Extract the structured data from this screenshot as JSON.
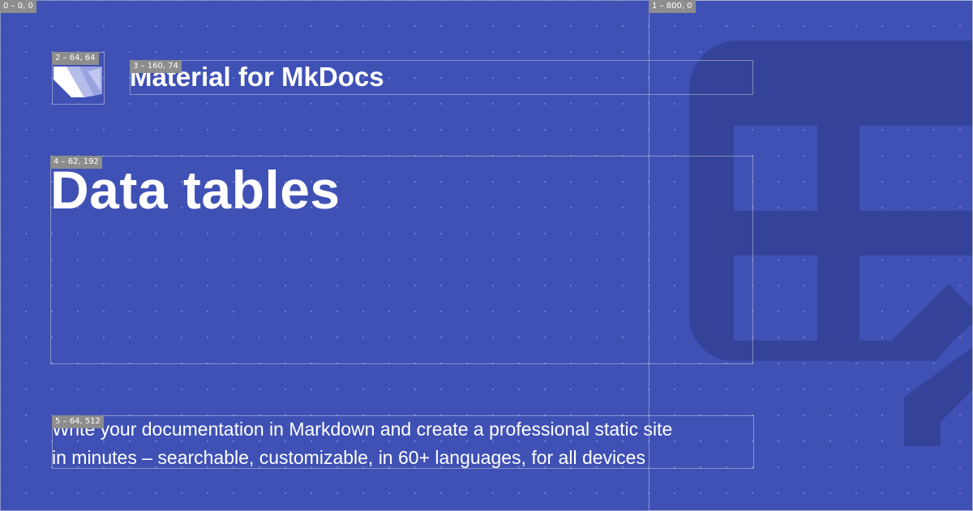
{
  "site": {
    "name": "Material for MkDocs",
    "logo_icon": "material-mkdocs-logo-icon"
  },
  "page": {
    "title": "Data tables",
    "background_icon": "table-edit-icon",
    "description_lines": [
      "Write your documentation in Markdown and create a professional static site",
      "in minutes – searchable, customizable, in 60+ languages, for all devices"
    ]
  },
  "debug_labels": {
    "box0": "0 – 0, 0",
    "box1": "1 – 800, 0",
    "box2": "2 – 64, 64",
    "box3": "3 – 160, 74",
    "box4": "4 – 62, 192",
    "box5": "5 – 64, 512"
  },
  "colors": {
    "background": "#3f51b5",
    "icon_shade": "#33408f",
    "text": "#ffffff",
    "debug_label_bg": "#8d8d8d"
  }
}
